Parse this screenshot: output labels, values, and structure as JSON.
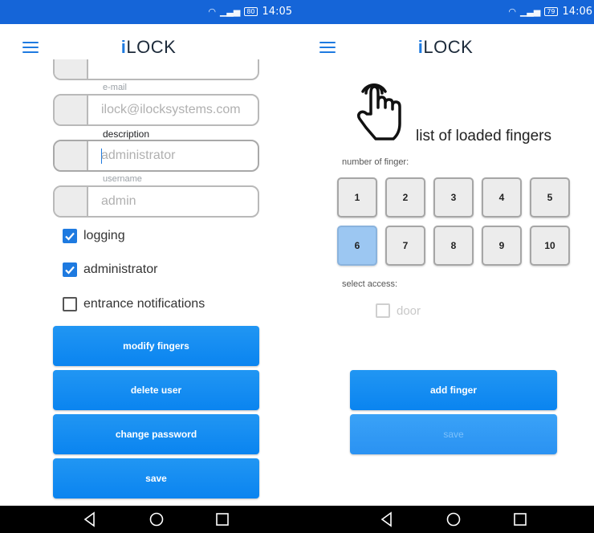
{
  "left": {
    "status": {
      "battery": "80",
      "time": "14:05"
    },
    "title": "iLOCK",
    "form": {
      "email_label": "e-mail",
      "email_placeholder": "ilock@ilocksystems.com",
      "description_label": "description",
      "description_placeholder": "administrator",
      "username_label": "username",
      "username_placeholder": "admin"
    },
    "checkboxes": [
      {
        "label": "logging",
        "checked": true
      },
      {
        "label": "administrator",
        "checked": true
      },
      {
        "label": "entrance notifications",
        "checked": false
      }
    ],
    "buttons": {
      "modify_fingers": "modify fingers",
      "delete_user": "delete user",
      "change_password": "change password",
      "save": "save"
    }
  },
  "right": {
    "status": {
      "battery": "79",
      "time": "14:06"
    },
    "title": "iLOCK",
    "list_title": "list of loaded fingers",
    "number_label": "number of finger:",
    "fingers": [
      "1",
      "2",
      "3",
      "4",
      "5",
      "6",
      "7",
      "8",
      "9",
      "10"
    ],
    "selected_finger": "6",
    "access_label": "select access:",
    "access_options": [
      {
        "label": "door",
        "checked": false
      }
    ],
    "buttons": {
      "add_finger": "add finger",
      "save": "save"
    }
  },
  "icons": {
    "menu": "hamburger-menu-icon",
    "hand": "hand-pointer-icon",
    "back": "back-triangle-icon",
    "home": "home-circle-icon",
    "recents": "recents-square-icon",
    "wifi": "wifi-icon",
    "signal": "signal-icon",
    "check": "checkmark-icon"
  },
  "colors": {
    "status_bar": "#1565d8",
    "accent": "#1e7ae0",
    "button": "#1a8cf2",
    "selected_finger": "#9cc7f2",
    "nav_bar": "#000000"
  }
}
